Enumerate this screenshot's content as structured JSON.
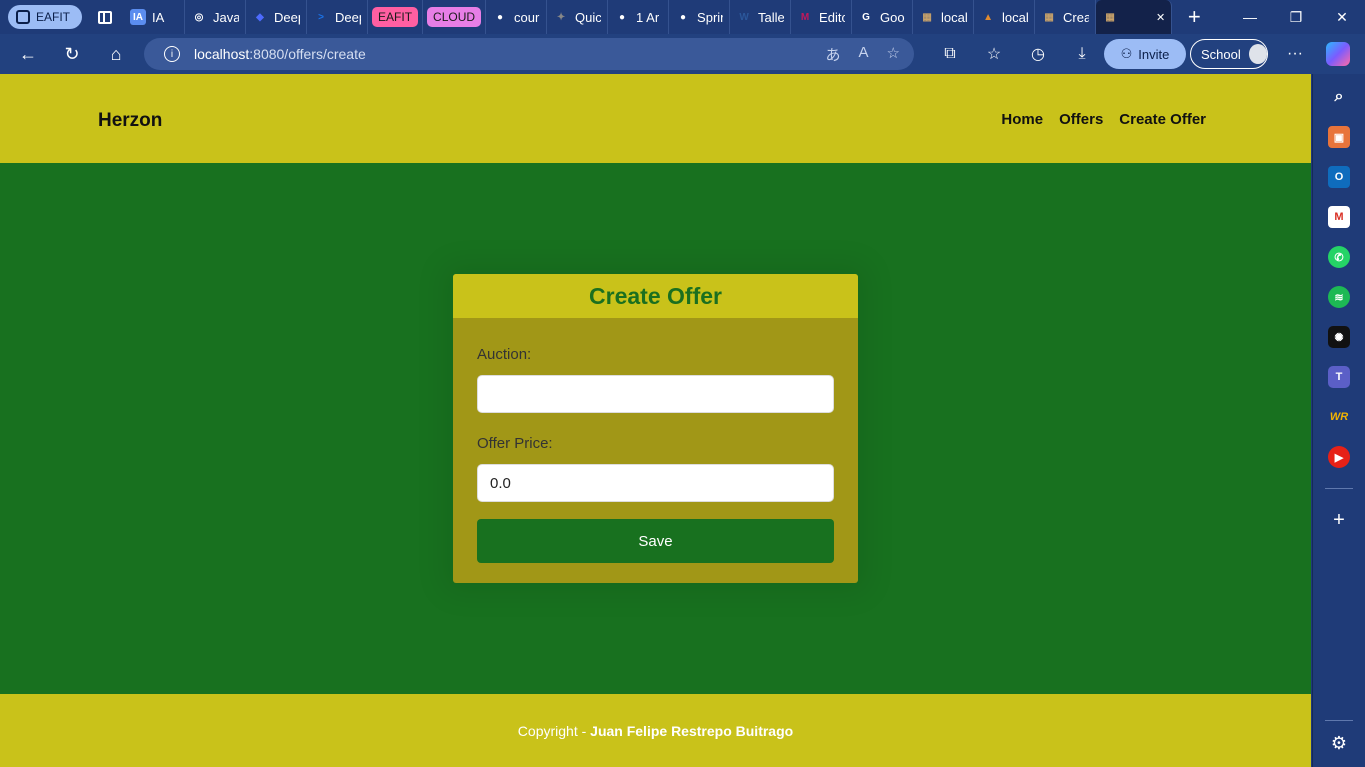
{
  "browser": {
    "profile_label": "EAFIT",
    "tabs": [
      {
        "title": "IA",
        "fav": "IA",
        "fav_color": "#5b8def",
        "kind": "fav-text"
      },
      {
        "title": "Java",
        "fav": "◎",
        "fav_color": "#ffffff"
      },
      {
        "title": "Deep",
        "fav": "◆",
        "fav_color": "#4d6bfe"
      },
      {
        "title": "Deep",
        "fav": ">",
        "fav_color": "#1a73e8"
      },
      {
        "title": "EAFIT",
        "kind": "chip",
        "chip_color": "#ff5fa2"
      },
      {
        "title": "CLOUD",
        "kind": "chip",
        "chip_color": "#e77ee6"
      },
      {
        "title": "cour",
        "fav": "●",
        "fav_color": "#ffffff"
      },
      {
        "title": "Quic",
        "fav": "✦",
        "fav_color": "#888888"
      },
      {
        "title": "1 Ar",
        "fav": "●",
        "fav_color": "#ffffff"
      },
      {
        "title": "Sprir",
        "fav": "●",
        "fav_color": "#ffffff"
      },
      {
        "title": "Talle",
        "fav": "W",
        "fav_color": "#2b579a"
      },
      {
        "title": "Edito",
        "fav": "M",
        "fav_color": "#c2185b"
      },
      {
        "title": "Goo",
        "fav": "G",
        "fav_color": "#ffffff"
      },
      {
        "title": "local",
        "fav": "▦",
        "fav_color": "#c8a26a"
      },
      {
        "title": "local",
        "fav": "▲",
        "fav_color": "#e08a2f"
      },
      {
        "title": "Crea",
        "fav": "▦",
        "fav_color": "#c8a26a"
      },
      {
        "title": "",
        "fav": "▦",
        "fav_color": "#c8a26a",
        "active": true
      }
    ],
    "window_controls": {
      "minimize": "—",
      "maximize": "❐",
      "close": "✕"
    },
    "address": {
      "host": "localhost",
      "path": ":8080/offers/create"
    },
    "invite_label": "Invite",
    "profile_button": "School"
  },
  "site": {
    "brand": "Herzon",
    "nav": [
      "Home",
      "Offers",
      "Create Offer"
    ],
    "form": {
      "title": "Create Offer",
      "auction_label": "Auction:",
      "auction_value": "",
      "price_label": "Offer Price:",
      "price_value": "0.0",
      "save_label": "Save"
    },
    "footer": {
      "prefix": "Copyright - ",
      "author": "Juan Felipe Restrepo Buitrago"
    }
  },
  "sidebar_icons": [
    "search-icon",
    "briefcase-icon",
    "outlook-icon",
    "gmail-icon",
    "whatsapp-icon",
    "spotify-icon",
    "chatgpt-icon",
    "teams-icon",
    "wr-icon",
    "youtube-icon",
    "add-icon",
    "settings-icon"
  ]
}
